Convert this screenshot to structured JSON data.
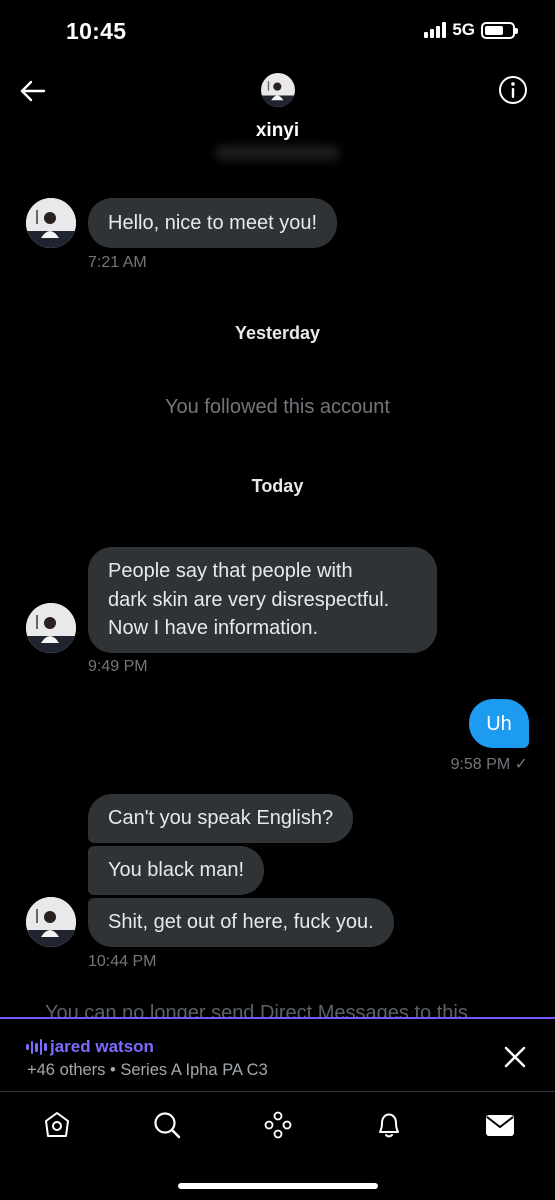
{
  "status_bar": {
    "time": "10:45",
    "network": "5G",
    "battery_level": 0.7
  },
  "header": {
    "name": "xinyi",
    "avatar_icon": "profile-avatar"
  },
  "messages": [
    {
      "text": "Hello, nice to meet you!",
      "time": "7:21 AM"
    },
    {
      "text": "People say that people with",
      "text2": "dark skin are very disrespectful.",
      "text3": "Now I have information.",
      "time": "9:49 PM"
    },
    {
      "text": "Uh",
      "time": "9:58 PM ✓"
    },
    {
      "text": "Can't you speak English?",
      "text2": "You black man!",
      "text3": "Shit, get out of here, fuck you.",
      "time": "10:44 PM"
    }
  ],
  "separators": {
    "yesterday": "Yesterday",
    "followed": "You followed this account",
    "today": "Today"
  },
  "footer_notice": "You can no longer send Direct Messages to this",
  "spaces": {
    "host": "jared watson",
    "subtitle": "+46 others • Series A Ipha PA C3",
    "accent": "#7856ff"
  },
  "colors": {
    "incoming_bubble": "#2f3336",
    "outgoing_bubble": "#1d9bf0"
  },
  "nav": [
    "home-icon",
    "search-icon",
    "spaces-icon",
    "notifications-icon",
    "messages-icon"
  ]
}
